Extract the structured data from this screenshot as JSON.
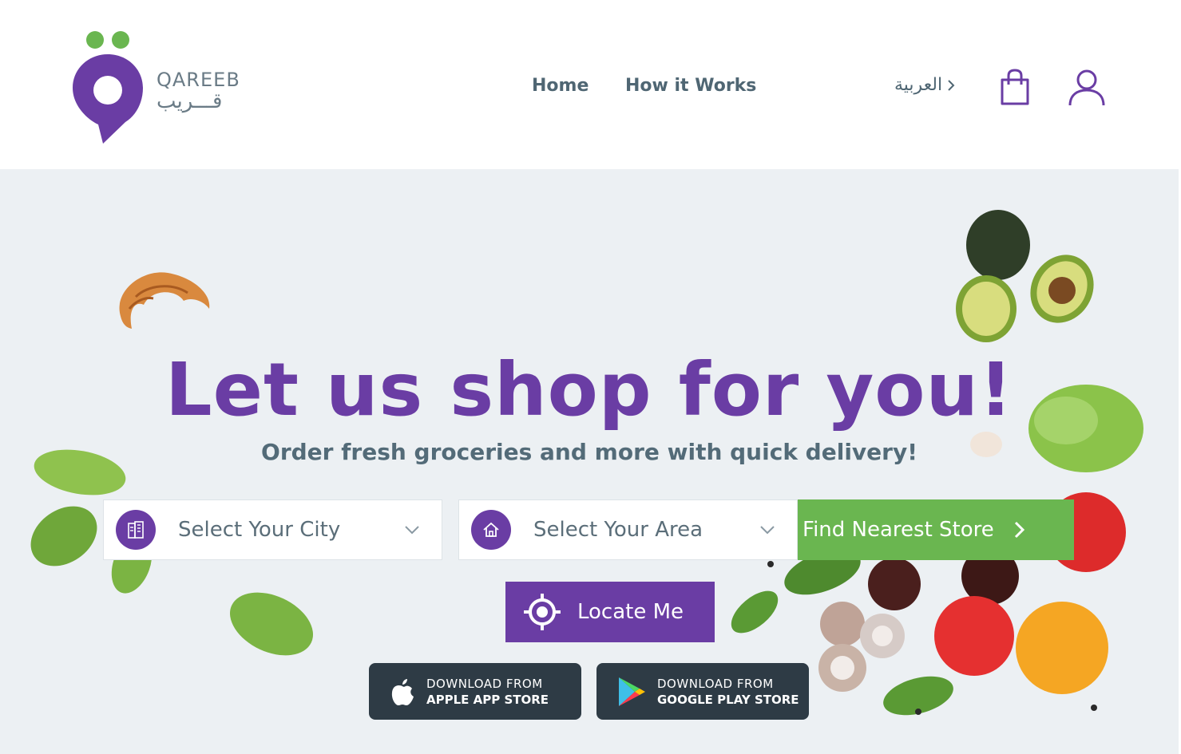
{
  "brand": {
    "name_en": "QAREEB",
    "name_ar": "قـــريب",
    "purple": "#6a3da4",
    "green": "#6ab650"
  },
  "nav": {
    "home": "Home",
    "how_it_works": "How it Works",
    "language": "العربية"
  },
  "header_icons": {
    "cart": "shopping-bag-icon",
    "account": "user-icon"
  },
  "hero": {
    "title": "Let us shop for you!",
    "subtitle": "Order fresh groceries and more with quick delivery!"
  },
  "search": {
    "city_placeholder": "Select Your City",
    "area_placeholder": "Select Your Area",
    "find_button": "Find Nearest Store",
    "locate_button": "Locate Me"
  },
  "app_stores": {
    "apple_top": "DOWNLOAD FROM",
    "apple_bottom": "APPLE APP STORE",
    "google_top": "DOWNLOAD FROM",
    "google_bottom": "GOOGLE PLAY STORE"
  }
}
